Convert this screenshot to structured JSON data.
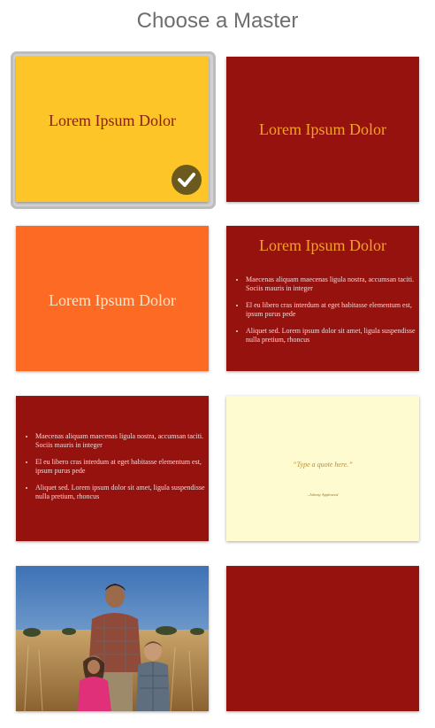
{
  "header": {
    "title": "Choose a Master"
  },
  "colors": {
    "yellow": "#fdc528",
    "dark_red": "#96120f",
    "orange": "#fc6a23",
    "cream": "#fefbd0",
    "gold_text": "#f5a21e",
    "dark_red_text": "#8b1c14",
    "cream_text": "#fde7cf",
    "check_bg": "#6b5a1e"
  },
  "masters": [
    {
      "title": "Lorem Ipsum Dolor",
      "selected": true,
      "icon": "checkmark-icon"
    },
    {
      "title": "Lorem Ipsum Dolor"
    },
    {
      "title": "Lorem Ipsum Dolor"
    },
    {
      "title": "Lorem Ipsum Dolor",
      "bullets": [
        "Maecenas aliquam maecenas ligula nostra, accumsan taciti. Sociis mauris in integer",
        "El eu libero cras interdum at eget habitasse elementum est, ipsum purus pede",
        "Aliquet sed. Lorem ipsum dolor sit amet, ligula suspendisse nulla pretium, rhoncus"
      ]
    },
    {
      "bullets": [
        "Maecenas aliquam maecenas ligula nostra, accumsan taciti. Sociis mauris in integer",
        "El eu libero cras interdum at eget habitasse elementum est, ipsum purus pede",
        "Aliquet sed. Lorem ipsum dolor sit amet, ligula suspendisse nulla pretium, rhoncus"
      ]
    },
    {
      "quote": "“Type a quote here.”",
      "attribution": "–Johnny Appleseed"
    },
    {
      "image_desc": "photo",
      "icon": "photo-icon"
    },
    {
      "blank": true
    }
  ]
}
